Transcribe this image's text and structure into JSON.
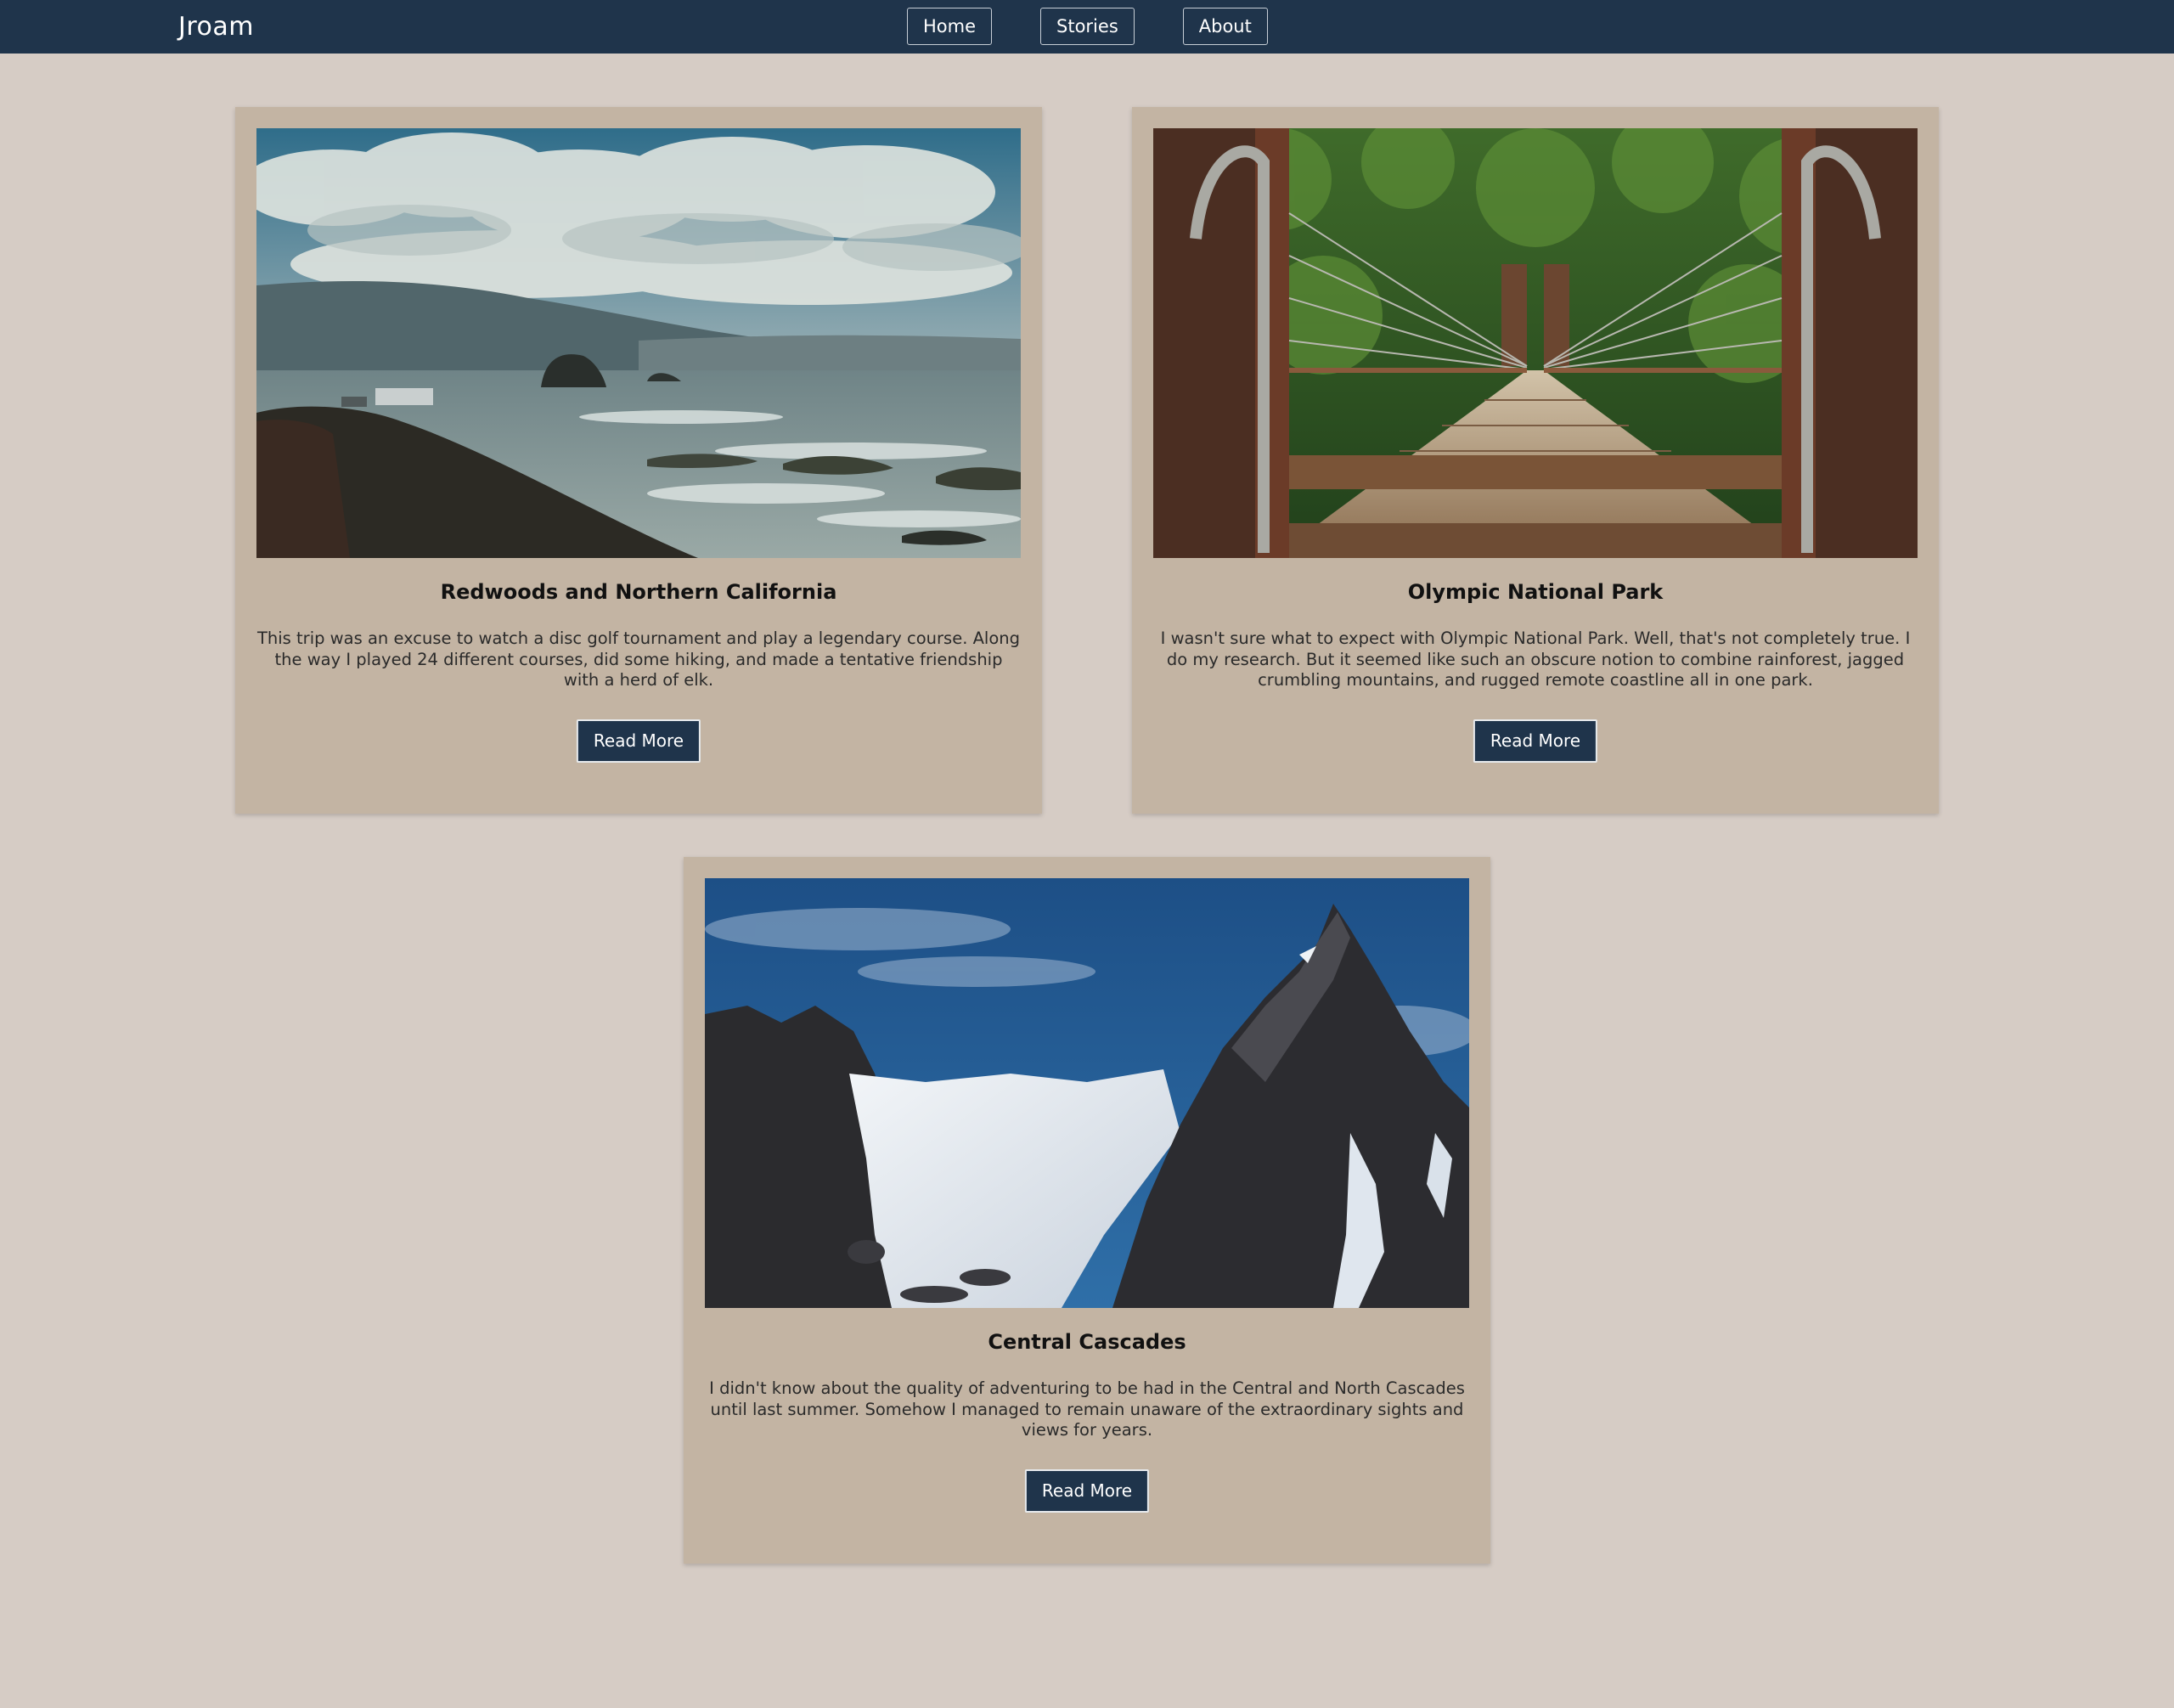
{
  "navbar": {
    "brand": "Jroam",
    "links": [
      {
        "label": "Home"
      },
      {
        "label": "Stories"
      },
      {
        "label": "About"
      }
    ]
  },
  "cards": [
    {
      "title": "Redwoods and Northern California",
      "text": "This trip was an excuse to watch a disc golf tournament and play a legendary course. Along the way I played 24 different courses, did some hiking, and made a tentative friendship with a herd of elk.",
      "button": "Read More",
      "image": "coastline-photo"
    },
    {
      "title": "Olympic National Park",
      "text": "I wasn't sure what to expect with Olympic National Park. Well, that's not completely true. I do my research. But it seemed like such an obscure notion to combine rainforest, jagged crumbling mountains, and rugged remote coastline all in one park.",
      "button": "Read More",
      "image": "suspension-bridge-photo"
    },
    {
      "title": "Central Cascades",
      "text": "I didn't know about the quality of adventuring to be had in the Central and North Cascades until last summer. Somehow I managed to remain unaware of the extraordinary sights and views for years.",
      "button": "Read More",
      "image": "snowy-peak-photo"
    }
  ],
  "colors": {
    "page_bg": "#d6ccc5",
    "navbar_bg": "#1f344b",
    "card_bg": "#c3b4a3",
    "button_bg": "#1f344b"
  }
}
